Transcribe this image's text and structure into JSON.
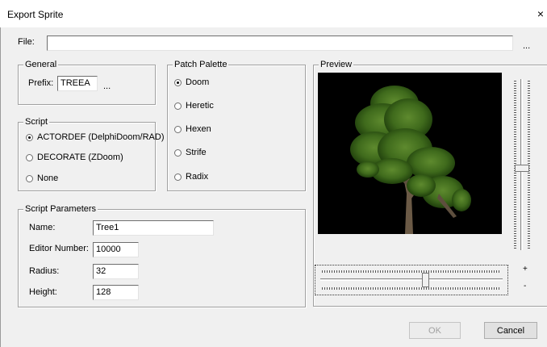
{
  "window": {
    "title": "Export Sprite",
    "close_glyph": "×"
  },
  "file": {
    "label": "File:",
    "value": "",
    "browse_label": "..."
  },
  "general": {
    "legend": "General",
    "prefix_label": "Prefix:",
    "prefix_value": "TREEA",
    "prefix_browse_label": "..."
  },
  "patch_palette": {
    "legend": "Patch Palette",
    "options": [
      {
        "label": "Doom",
        "selected": true
      },
      {
        "label": "Heretic",
        "selected": false
      },
      {
        "label": "Hexen",
        "selected": false
      },
      {
        "label": "Strife",
        "selected": false
      },
      {
        "label": "Radix",
        "selected": false
      }
    ]
  },
  "script": {
    "legend": "Script",
    "options": [
      {
        "label": "ACTORDEF (DelphiDoom/RAD)",
        "selected": true
      },
      {
        "label": "DECORATE (ZDoom)",
        "selected": false
      },
      {
        "label": "None",
        "selected": false
      }
    ]
  },
  "script_parameters": {
    "legend": "Script Parameters",
    "name_label": "Name:",
    "name_value": "Tree1",
    "editor_number_label": "Editor Number:",
    "editor_number_value": "10000",
    "radius_label": "Radius:",
    "radius_value": "32",
    "height_label": "Height:",
    "height_value": "128"
  },
  "preview": {
    "legend": "Preview",
    "zoom_in_label": "+",
    "zoom_out_label": "-",
    "background_color": "#000000",
    "horizontal_slider_level": 0.58,
    "vertical_slider_level": 0.52
  },
  "buttons": {
    "ok_label": "OK",
    "cancel_label": "Cancel"
  }
}
